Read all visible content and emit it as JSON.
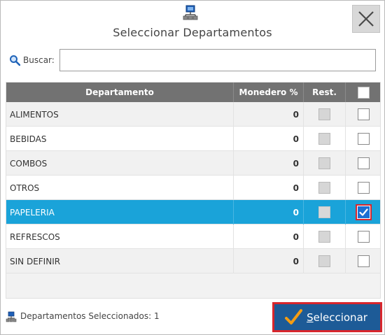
{
  "dialog": {
    "title": "Seleccionar Departamentos",
    "header_icon": "network-icon",
    "close_icon": "close-icon"
  },
  "search": {
    "label": "Buscar:",
    "value": "",
    "placeholder": "",
    "icon": "search-icon"
  },
  "table": {
    "columns": [
      "Departamento",
      "Monedero %",
      "Rest.",
      ""
    ],
    "rows": [
      {
        "departamento": "ALIMENTOS",
        "monedero": "0",
        "rest": false,
        "checked": false,
        "selected": false
      },
      {
        "departamento": "BEBIDAS",
        "monedero": "0",
        "rest": false,
        "checked": false,
        "selected": false
      },
      {
        "departamento": "COMBOS",
        "monedero": "0",
        "rest": false,
        "checked": false,
        "selected": false
      },
      {
        "departamento": "OTROS",
        "monedero": "0",
        "rest": false,
        "checked": false,
        "selected": false
      },
      {
        "departamento": "PAPELERIA",
        "monedero": "0",
        "rest": false,
        "checked": true,
        "selected": true
      },
      {
        "departamento": "REFRESCOS",
        "monedero": "0",
        "rest": false,
        "checked": false,
        "selected": false
      },
      {
        "departamento": "SIN DEFINIR",
        "monedero": "0",
        "rest": false,
        "checked": false,
        "selected": false
      }
    ]
  },
  "footer": {
    "label": "Departamentos Seleccionados:",
    "count": "1",
    "icon": "network-icon"
  },
  "select_button": {
    "label_first": "S",
    "label_rest": "eleccionar",
    "icon": "checkmark-icon"
  },
  "colors": {
    "header_bg": "#727272",
    "selected_row": "#1aa3d9",
    "button_bg": "#1d5b97",
    "button_border": "#d8262c",
    "checkbox_checked": "#1c6fd3"
  }
}
